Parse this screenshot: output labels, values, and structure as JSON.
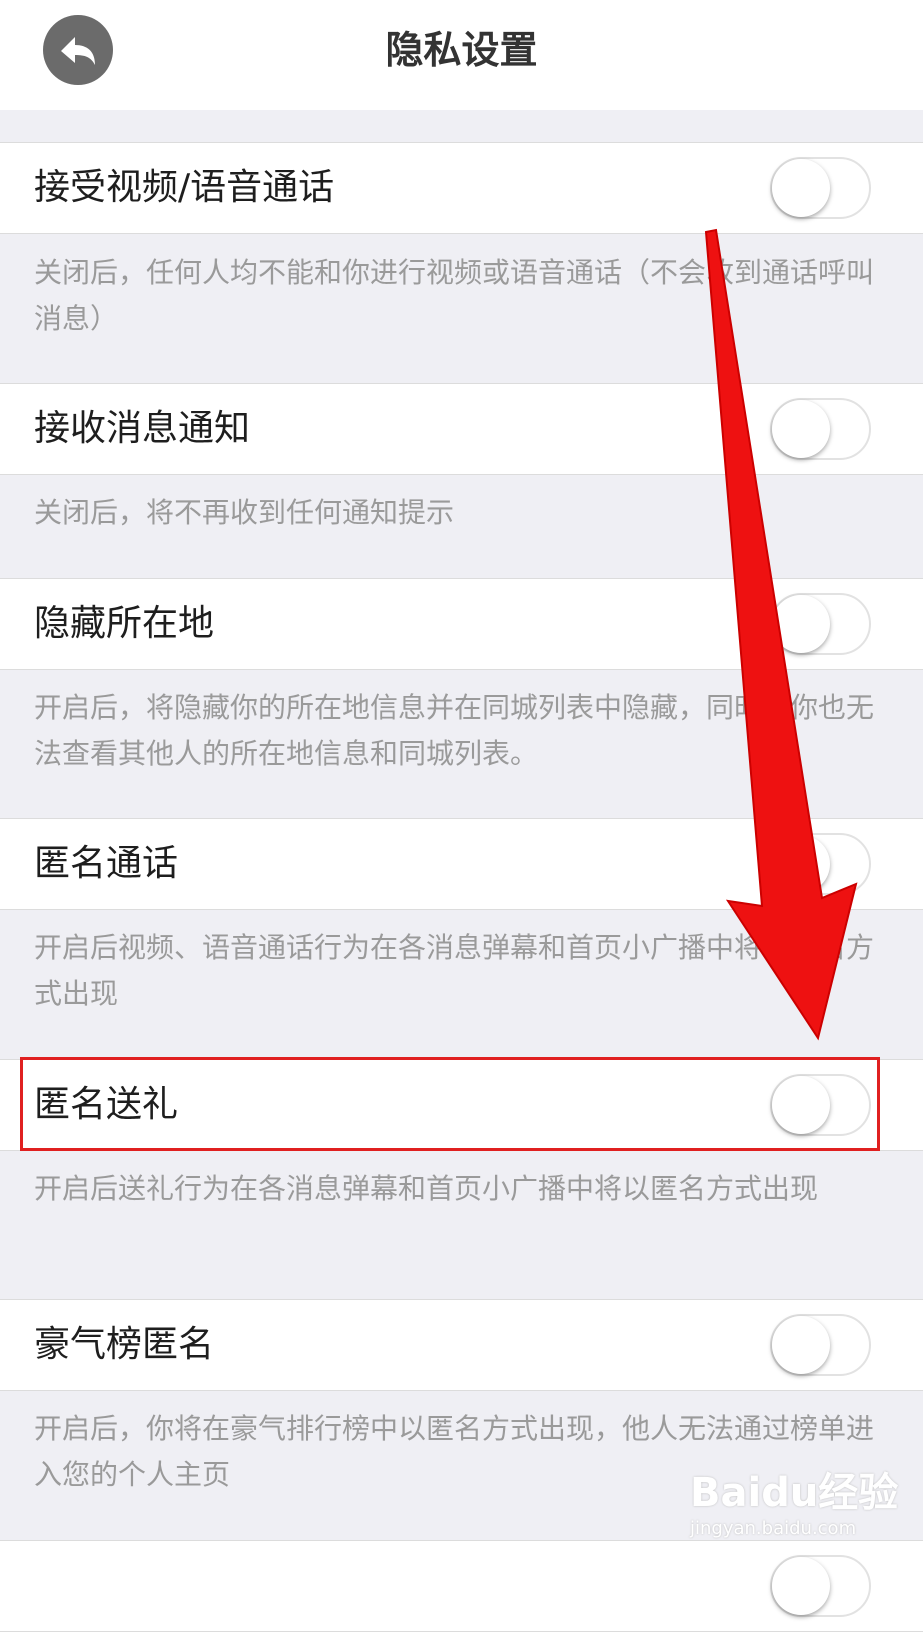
{
  "header": {
    "title": "隐私设置"
  },
  "settings": [
    {
      "label": "接受视频/语音通话",
      "enabled": false,
      "desc": "关闭后，任何人均不能和你进行视频或语音通话（不会收到通话呼叫消息）"
    },
    {
      "label": "接收消息通知",
      "enabled": false,
      "desc": "关闭后，将不再收到任何通知提示"
    },
    {
      "label": "隐藏所在地",
      "enabled": false,
      "desc": "开启后，将隐藏你的所在地信息并在同城列表中隐藏，同时，你也无法查看其他人的所在地信息和同城列表。"
    },
    {
      "label": "匿名通话",
      "enabled": false,
      "desc": "开启后视频、语音通话行为在各消息弹幕和首页小广播中将以匿名方式出现"
    },
    {
      "label": "匿名送礼",
      "enabled": false,
      "desc": "开启后送礼行为在各消息弹幕和首页小广播中将以匿名方式出现"
    },
    {
      "label": "豪气榜匿名",
      "enabled": false,
      "desc": "开启后，你将在豪气排行榜中以匿名方式出现，他人无法通过榜单进入您的个人主页"
    }
  ],
  "watermark": {
    "main": "Baidu经验",
    "sub": "jingyan.baidu.com"
  },
  "colors": {
    "annotation": "#e01010",
    "background": "#efeff4"
  }
}
